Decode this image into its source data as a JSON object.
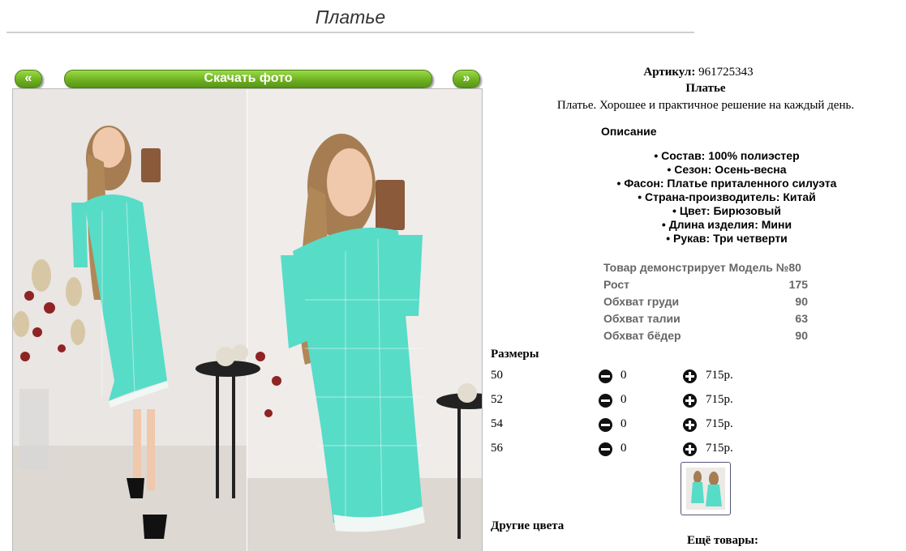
{
  "page": {
    "title": "Платье"
  },
  "gallery": {
    "prev_label": "«",
    "download_label": "Скачать фото",
    "next_label": "»"
  },
  "product": {
    "article_label": "Артикул:",
    "article_value": "961725343",
    "name": "Платье",
    "short_description": "Платье. Хорошее и практичное решение на каждый день."
  },
  "description": {
    "heading": "Описание",
    "features": [
      "Состав: 100% полиэстер",
      "Сезон: Осень-весна",
      "Фасон: Платье приталенного силуэта",
      "Страна-производитель: Китай",
      "Цвет: Бирюзовый",
      "Длина изделия: Мини",
      "Рукав: Три четверти"
    ]
  },
  "model": {
    "title": "Товар демонстрирует Модель №80",
    "rows": [
      {
        "label": "Рост",
        "value": "175"
      },
      {
        "label": "Обхват груди",
        "value": "90"
      },
      {
        "label": "Обхват талии",
        "value": "63"
      },
      {
        "label": "Обхват бёдер",
        "value": "90"
      }
    ]
  },
  "sizes": {
    "heading": "Размеры",
    "rows": [
      {
        "size": "50",
        "qty": "0",
        "price": "715р."
      },
      {
        "size": "52",
        "qty": "0",
        "price": "715р."
      },
      {
        "size": "54",
        "qty": "0",
        "price": "715р."
      },
      {
        "size": "56",
        "qty": "0",
        "price": "715р."
      }
    ]
  },
  "other_colors": {
    "heading": "Другие цвета"
  },
  "more_products": {
    "heading": "Ещё товары:"
  },
  "colors": {
    "accent_green": "#6fb11f",
    "dress_turquoise": "#57dcc8"
  }
}
